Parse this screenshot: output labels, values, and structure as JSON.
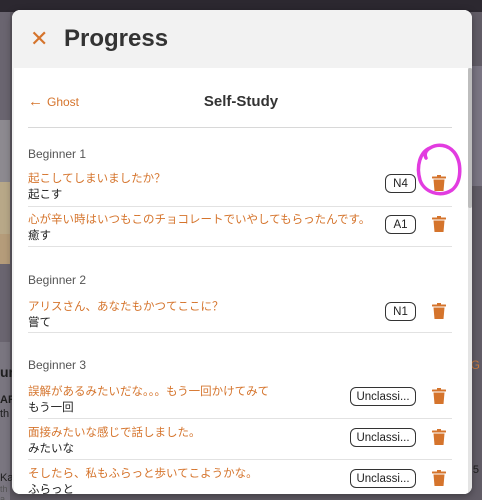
{
  "background": {
    "left_fragments": [
      "ur",
      "AR",
      "th",
      "Ka",
      "th a"
    ],
    "right_fragments": [
      "G",
      "5"
    ]
  },
  "modal": {
    "title": "Progress",
    "close_icon": "close-icon",
    "back_label": "Ghost",
    "subtitle": "Self-Study",
    "accent_color": "#d5742c",
    "sections": [
      {
        "title": "Beginner 1",
        "items": [
          {
            "sentence": "起こしてしまいましたか？",
            "word": "起こす",
            "level": "N4"
          },
          {
            "sentence": "心が辛い時はいつもこのチョコレートでいやしてもらったんです。",
            "word": "癒す",
            "level": "A1"
          }
        ]
      },
      {
        "title": "Beginner 2",
        "items": [
          {
            "sentence": "アリスさん、あなたもかつてここに？",
            "word": "嘗て",
            "level": "N1"
          }
        ]
      },
      {
        "title": "Beginner 3",
        "items": [
          {
            "sentence": "誤解があるみたいだな。。。もう一回かけてみて",
            "word": "もう一回",
            "level": "Unclassi..."
          },
          {
            "sentence": "面接みたいな感じで話しました。",
            "word": "みたいな",
            "level": "Unclassi..."
          },
          {
            "sentence": "そしたら、私もふらっと歩いてこようかな。",
            "word": "ふらっと",
            "level": "Unclassi..."
          }
        ]
      }
    ]
  }
}
